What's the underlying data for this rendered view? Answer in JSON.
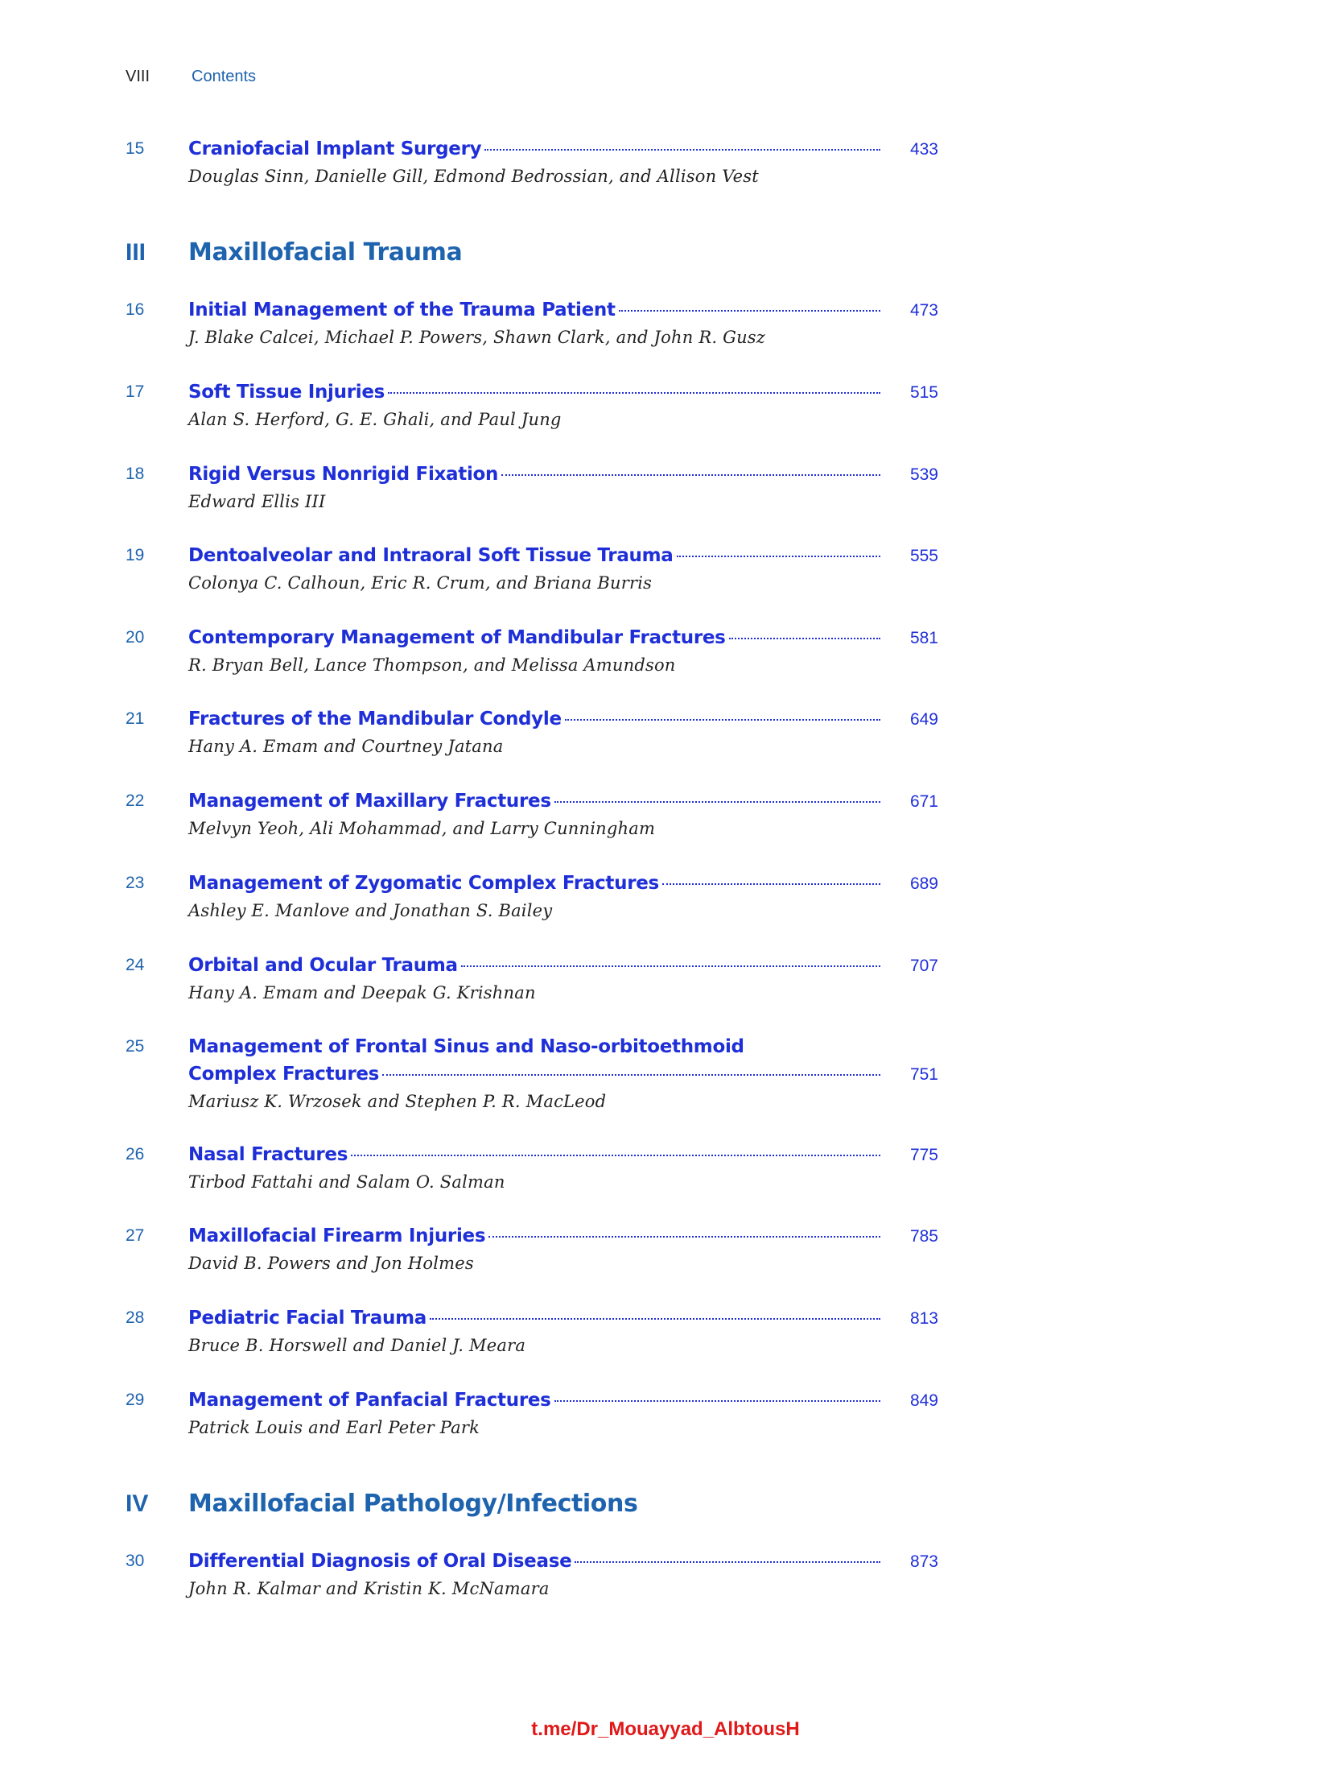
{
  "header": {
    "page_number": "VIII",
    "running_title": "Contents"
  },
  "toc": {
    "entries": [
      {
        "num": "15",
        "title": "Craniofacial Implant Surgery",
        "page": "433",
        "authors": "Douglas Sinn, Danielle Gill, Edmond Bedrossian, and Allison Vest"
      },
      {
        "num": "16",
        "title": "Initial Management of the Trauma Patient",
        "page": "473",
        "authors": "J. Blake Calcei, Michael P. Powers, Shawn Clark, and John R. Gusz"
      },
      {
        "num": "17",
        "title": "Soft Tissue Injuries",
        "page": "515",
        "authors": "Alan S. Herford, G. E. Ghali, and Paul Jung"
      },
      {
        "num": "18",
        "title": "Rigid Versus Nonrigid Fixation",
        "page": "539",
        "authors": "Edward Ellis III"
      },
      {
        "num": "19",
        "title": "Dentoalveolar and Intraoral Soft Tissue Trauma",
        "page": "555",
        "authors": "Colonya C. Calhoun, Eric R. Crum, and Briana Burris"
      },
      {
        "num": "20",
        "title": "Contemporary Management of Mandibular Fractures",
        "page": "581",
        "authors": "R. Bryan Bell, Lance Thompson, and Melissa Amundson"
      },
      {
        "num": "21",
        "title": "Fractures of the Mandibular Condyle",
        "page": "649",
        "authors": "Hany A. Emam and Courtney Jatana"
      },
      {
        "num": "22",
        "title": "Management of Maxillary Fractures",
        "page": "671",
        "authors": "Melvyn Yeoh, Ali Mohammad, and Larry Cunningham"
      },
      {
        "num": "23",
        "title": "Management of Zygomatic Complex Fractures",
        "page": "689",
        "authors": "Ashley E. Manlove and Jonathan S. Bailey"
      },
      {
        "num": "24",
        "title": "Orbital and Ocular Trauma",
        "page": "707",
        "authors": "Hany A. Emam and Deepak G. Krishnan"
      },
      {
        "num": "25",
        "title_line1": "Management of Frontal Sinus and Naso-orbitoethmoid",
        "title": "Complex Fractures",
        "page": "751",
        "authors": "Mariusz K. Wrzosek and Stephen P. R. MacLeod"
      },
      {
        "num": "26",
        "title": "Nasal Fractures",
        "page": "775",
        "authors": "Tirbod Fattahi and Salam O. Salman"
      },
      {
        "num": "27",
        "title": "Maxillofacial Firearm Injuries",
        "page": "785",
        "authors": "David B. Powers and Jon Holmes"
      },
      {
        "num": "28",
        "title": "Pediatric Facial Trauma",
        "page": "813",
        "authors": "Bruce B. Horswell and Daniel J. Meara"
      },
      {
        "num": "29",
        "title": "Management of Panfacial Fractures",
        "page": "849",
        "authors": "Patrick Louis and Earl Peter Park"
      },
      {
        "num": "30",
        "title": "Differential Diagnosis of Oral Disease",
        "page": "873",
        "authors": "John R. Kalmar and Kristin K. McNamara"
      }
    ],
    "parts": [
      {
        "num": "III",
        "title": "Maxillofacial Trauma"
      },
      {
        "num": "IV",
        "title": "Maxillofacial Pathology/Infections"
      }
    ]
  },
  "watermark": "t.me/Dr_Mouayyad_AlbtousH"
}
